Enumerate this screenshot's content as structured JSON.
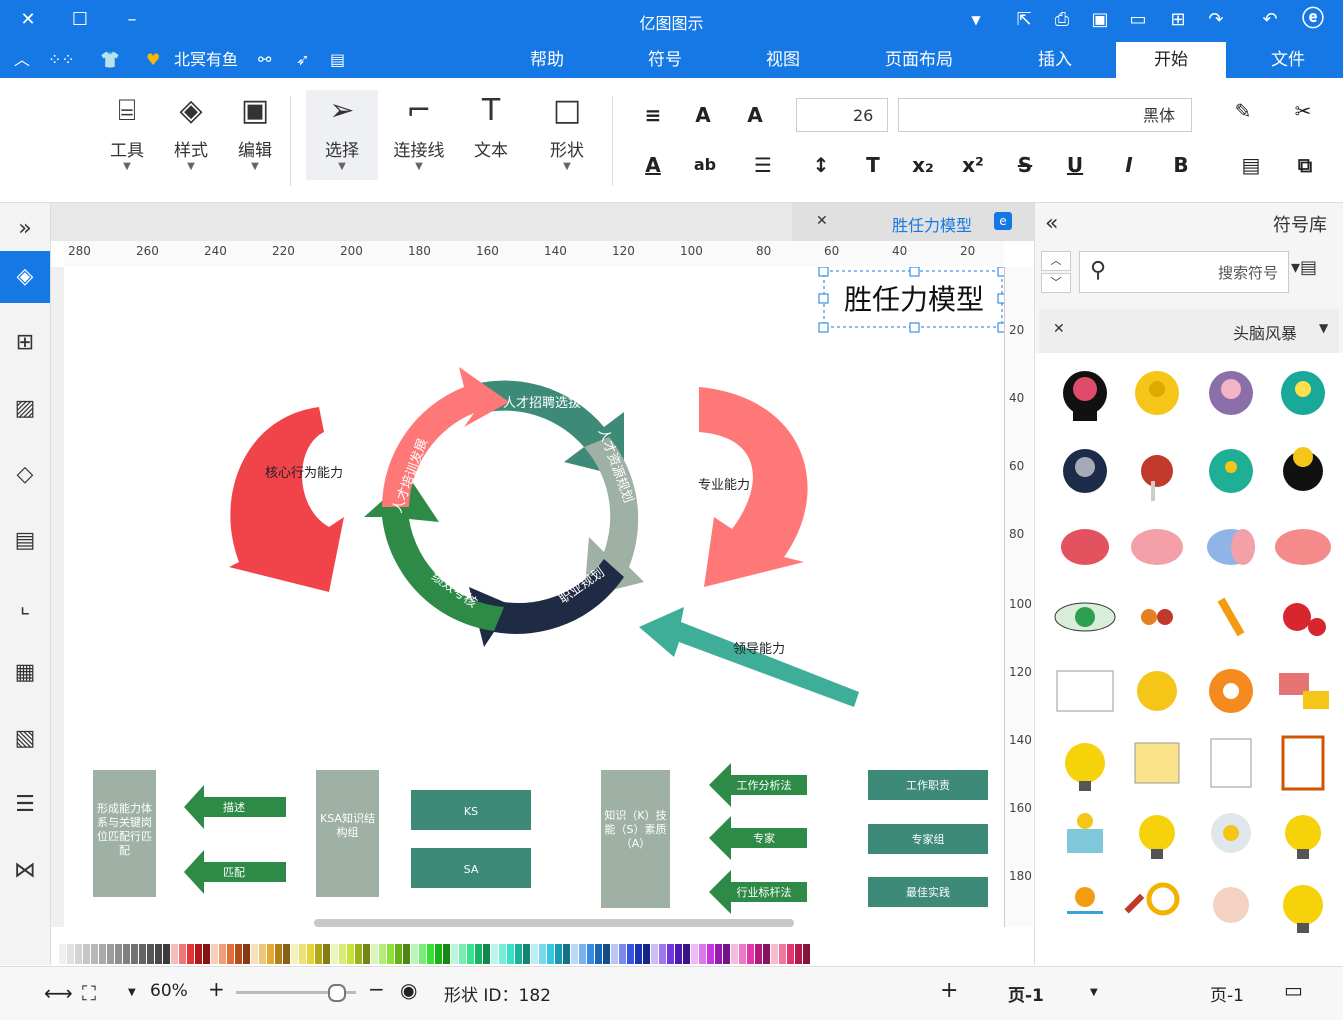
{
  "app": {
    "title": "亿图图示"
  },
  "menubar": {
    "tabs": [
      "文件",
      "开始",
      "插入",
      "页面布局",
      "视图",
      "符号",
      "帮助"
    ],
    "active_tab": "开始",
    "user": "北冥有鱼"
  },
  "ribbon": {
    "font_name": "黑体",
    "font_size": "26",
    "tools": {
      "shape": "形状",
      "text": "文本",
      "connector": "连接线",
      "select": "选择",
      "edit": "编辑",
      "style": "样式",
      "tools": "工具"
    },
    "format_buttons": [
      "B",
      "I",
      "U",
      "S",
      "x²",
      "x₂"
    ]
  },
  "doc": {
    "tab_title": "胜任力模型",
    "diagram_title": "胜任力模型",
    "ruler_ticks": [
      "20",
      "40",
      "60",
      "80",
      "100",
      "120",
      "140",
      "160",
      "180",
      "200",
      "220",
      "240",
      "260",
      "280"
    ],
    "vruler_ticks": [
      "20",
      "40",
      "60",
      "80",
      "100",
      "120",
      "140",
      "160",
      "180"
    ],
    "cycle_labels": [
      "人才招聘选拔",
      "人才资源规划",
      "职业规划",
      "绩效考核",
      "人才培训发展"
    ],
    "side_labels": {
      "core": "核心行为能力",
      "pro": "专业能力",
      "lead": "领导能力"
    },
    "bottom": {
      "grey_left": "形成能力体系与关键岗位匹配行匹配",
      "arrow_describe": "描述",
      "arrow_match": "匹配",
      "grey_mid": "KSA知识结构组",
      "teal_ks": "KS",
      "teal_sa": "SA",
      "grey_right": "知识（K）技能（S）素质（A）",
      "arrow_work": "工作分析法",
      "arrow_expert": "专家",
      "arrow_bench": "行业标杆法",
      "teal_duty": "工作职责",
      "teal_expert": "专家组",
      "teal_best": "最佳实践"
    }
  },
  "library": {
    "title": "符号库",
    "search_placeholder": "搜索符号",
    "category": "头脑风暴"
  },
  "status": {
    "page_left": "页-1",
    "page_tab": "页-1",
    "shape_id": "形状 ID：182",
    "zoom": "60%"
  },
  "colors": {
    "accent": "#1678e4",
    "red": "#f0444a",
    "salmon": "#ff7878",
    "teal": "#3e8a78",
    "green": "#2e8b47",
    "navy": "#1f2b44",
    "grey": "#9fb0a5",
    "teal_light": "#3fae98"
  }
}
